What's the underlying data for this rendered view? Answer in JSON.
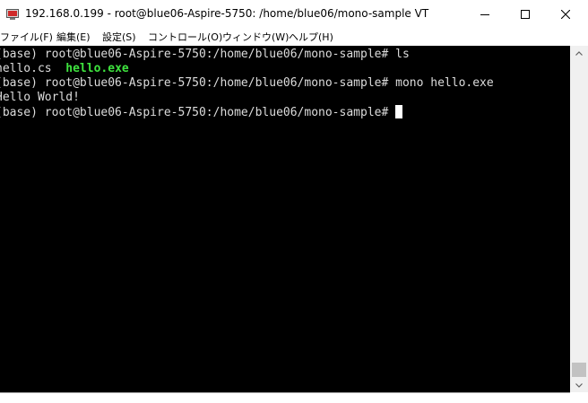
{
  "window": {
    "title": "192.168.0.199 - root@blue06-Aspire-5750: /home/blue06/mono-sample VT",
    "icon": "teraterm-icon"
  },
  "menu": [
    {
      "label": "ファイル(F)"
    },
    {
      "label": "編集(E)"
    },
    {
      "label": "設定(S)"
    },
    {
      "label": "コントロール(O)"
    },
    {
      "label": "ウィンドウ(W)"
    },
    {
      "label": "ヘルプ(H)"
    }
  ],
  "terminal": {
    "prompt": "(base) root@blue06-Aspire-5750:/home/blue06/mono-sample# ",
    "lines": [
      {
        "command": "ls"
      },
      {
        "file1": "hello.cs",
        "spacer": "  ",
        "file2": "hello.exe"
      },
      {
        "command": "mono hello.exe"
      },
      {
        "output": "Hello World!"
      }
    ]
  },
  "colors": {
    "terminal_background": "#000000",
    "terminal_text": "#dcdcdc",
    "executable_file": "#3fe43f",
    "cursor": "#ffffff"
  }
}
